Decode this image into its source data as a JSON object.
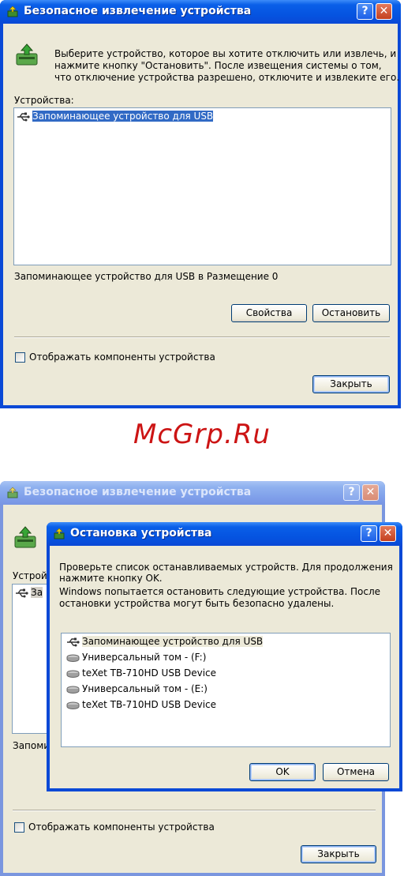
{
  "watermark": "McGrp.Ru",
  "top_dialog": {
    "title": "Безопасное извлечение устройства",
    "help_button": "?",
    "close_button": "✕",
    "instructions": [
      "Выберите устройство, которое вы хотите отключить или извлечь, и",
      "нажмите кнопку \"Остановить\". После извещения системы о том,",
      "что отключение устройства разрешено, отключите и извлеките его."
    ],
    "devices_label": "Устройства:",
    "devices": [
      "Запоминающее устройство для USB"
    ],
    "location_text": "Запоминающее устройство для USB в Размещение 0",
    "properties_button": "Свойства",
    "stop_button": "Остановить",
    "show_components_label": "Отображать компоненты устройства",
    "show_components_checked": false,
    "close_dialog_button": "Закрыть"
  },
  "bottom_scene": {
    "back_dialog": {
      "title": "Безопасное извлечение устройства",
      "help_button": "?",
      "close_button": "✕",
      "devices_label_partial": "Устрой",
      "device_partial": "За",
      "location_partial": "Запоми",
      "show_components_label": "Отображать компоненты устройства",
      "close_dialog_button": "Закрыть"
    },
    "stop_dialog": {
      "title": "Остановка устройства",
      "help_button": "?",
      "close_button": "✕",
      "text1": [
        "Проверьте список останавливаемых устройств. Для продолжения",
        "нажмите кнопку OK."
      ],
      "text2": [
        "Windows попытается остановить следующие устройства. После",
        "остановки устройства могут быть безопасно удалены."
      ],
      "devices": [
        {
          "icon": "usb-icon",
          "label": "Запоминающее устройство для USB"
        },
        {
          "icon": "drive-icon",
          "label": "Универсальный том - (F:)"
        },
        {
          "icon": "drive-icon",
          "label": "teXet TB-710HD USB Device"
        },
        {
          "icon": "drive-icon",
          "label": "Универсальный том - (E:)"
        },
        {
          "icon": "drive-icon",
          "label": "teXet TB-710HD USB Device"
        }
      ],
      "ok_button": "OK",
      "cancel_button": "Отмена"
    }
  },
  "colors": {
    "title_active": "#0553e0",
    "title_inactive": "#7f9fea",
    "face": "#ece9d8",
    "selection": "#316ac5",
    "watermark": "#cc1414"
  }
}
